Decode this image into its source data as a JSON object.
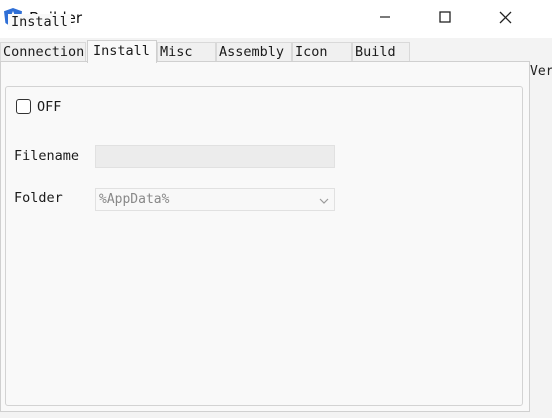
{
  "window": {
    "title": "Builder"
  },
  "tabs": [
    {
      "label": "Connection"
    },
    {
      "label": "Install"
    },
    {
      "label": "Misc"
    },
    {
      "label": "Assembly"
    },
    {
      "label": "Icon"
    },
    {
      "label": "Build"
    }
  ],
  "active_tab": "Install",
  "clipped_tab_fragment": "Ver",
  "install_group": {
    "legend": "Install",
    "toggle": {
      "label": "OFF",
      "checked": false
    },
    "filename": {
      "label": "Filename",
      "value": ""
    },
    "folder": {
      "label": "Folder",
      "selected": "%AppData%"
    }
  },
  "icons": {
    "app": "angular-a-shield-icon",
    "minimize": "minimize-icon",
    "maximize": "maximize-icon",
    "close": "close-icon",
    "dropdown": "chevron-down-icon"
  },
  "colors": {
    "app_icon": "#2f6fd6",
    "title_bar": "#ffffff",
    "panel": "#f9f9f9"
  }
}
